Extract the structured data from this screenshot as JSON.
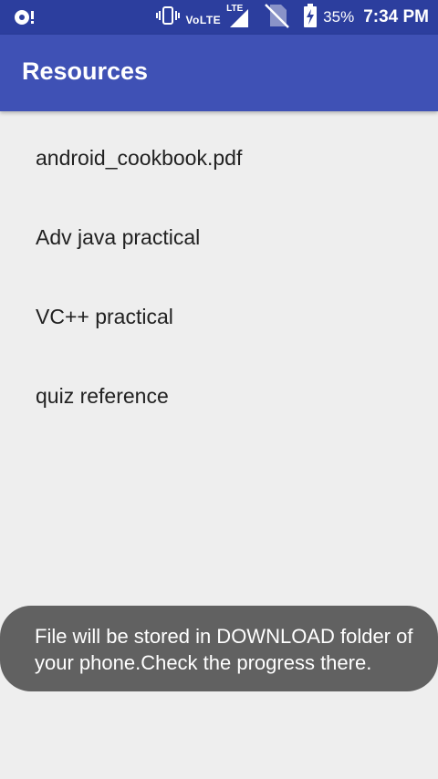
{
  "status_bar": {
    "network_label": "VoLTE",
    "lte_label": "LTE",
    "battery_percent": "35%",
    "time": "7:34 PM",
    "icons": [
      "sync-icon",
      "vibrate-icon",
      "signal-icon",
      "no-sim-icon",
      "battery-charging-icon"
    ]
  },
  "app_bar": {
    "title": "Resources"
  },
  "resources": {
    "items": [
      {
        "label": "android_cookbook.pdf"
      },
      {
        "label": "Adv java practical"
      },
      {
        "label": "VC++ practical"
      },
      {
        "label": "quiz reference"
      }
    ]
  },
  "toast": {
    "message": "File will be stored in DOWNLOAD folder of your phone.Check the progress there."
  },
  "colors": {
    "status_bar": "#2c3e9e",
    "app_bar": "#3f51b5",
    "background": "#eeeeee",
    "toast": "#616161"
  }
}
